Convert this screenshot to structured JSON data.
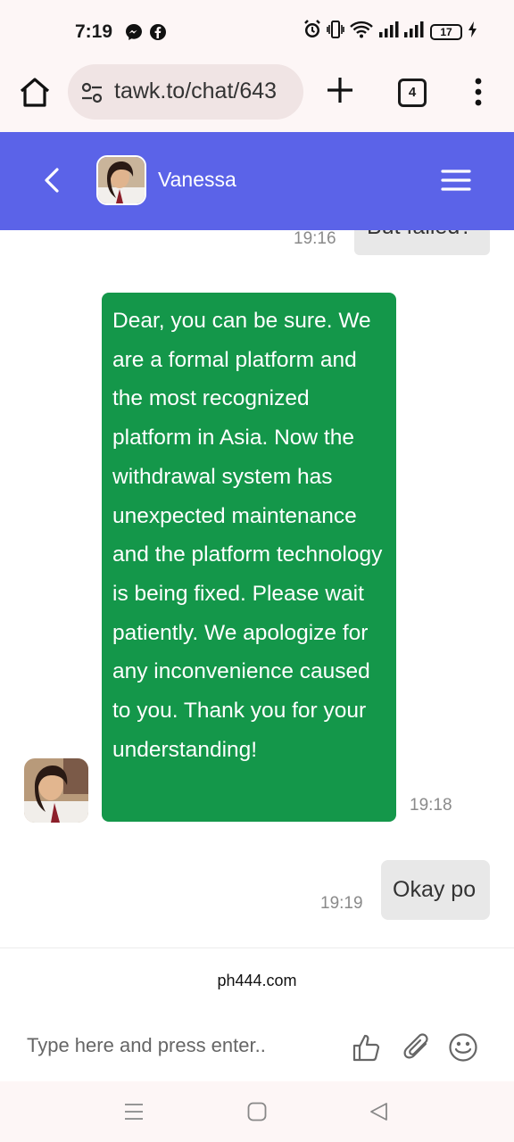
{
  "status_bar": {
    "time": "7:19",
    "battery": "17",
    "icons": [
      "messenger-icon",
      "facebook-icon",
      "alarm-icon",
      "vibrate-icon",
      "wifi-icon",
      "signal-icon",
      "battery-icon",
      "charging-icon"
    ]
  },
  "browser": {
    "url": "tawk.to/chat/643",
    "tab_count": "4",
    "icons": [
      "home-icon",
      "tune-icon",
      "plus-icon",
      "tabs-icon",
      "kebab-icon"
    ]
  },
  "chat_header": {
    "agent_name": "Vanessa",
    "accent": "#5b63e8",
    "icons": [
      "back-icon",
      "avatar",
      "menu-icon"
    ]
  },
  "messages": [
    {
      "sender": "visitor",
      "text": "But failed?",
      "time": "19:16"
    },
    {
      "sender": "agent",
      "text": "Dear, you can be sure. We are a formal platform and the most recognized platform in Asia. Now the withdrawal system has unexpected maintenance and the platform technology is being fixed. Please wait patiently. We apologize for any inconvenience caused to you. Thank you for your understanding!",
      "time": "19:18",
      "color": "#14974a"
    },
    {
      "sender": "visitor",
      "text": "Okay po",
      "time": "19:19"
    }
  ],
  "footer": {
    "brand_link": "ph444.com",
    "input_placeholder": "Type here and press enter..",
    "icons": [
      "thumbs-up-icon",
      "paperclip-icon",
      "emoji-icon"
    ]
  },
  "nav_bar": {
    "icons": [
      "recent-apps-icon",
      "home-nav-icon",
      "back-nav-icon"
    ]
  }
}
